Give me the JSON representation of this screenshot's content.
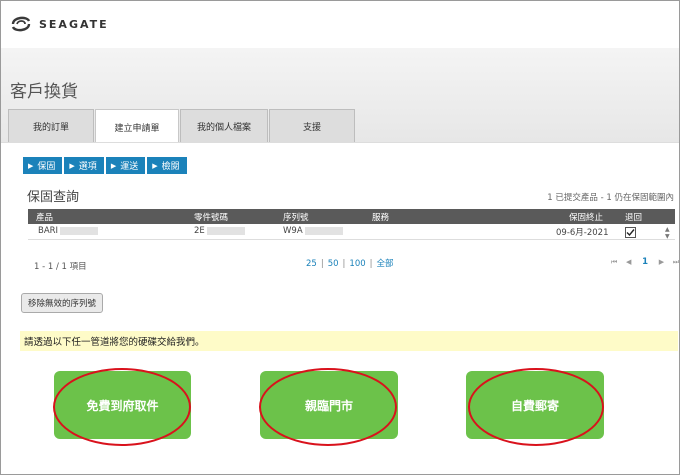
{
  "brand": {
    "logo_text": "SEAGATE",
    "logo_icon": "seagate-swirl-icon"
  },
  "page_title": "客戶換貨",
  "tabs": [
    {
      "label": "我的訂單",
      "active": false
    },
    {
      "label": "建立申請單",
      "active": true
    },
    {
      "label": "我的個人檔案",
      "active": false
    },
    {
      "label": "支援",
      "active": false
    }
  ],
  "steps": [
    "保固",
    "選項",
    "運送",
    "檢閱"
  ],
  "warranty": {
    "title": "保固查詢",
    "summary": "1 已提交產品 - 1 仍在保固範圍內",
    "columns": [
      "產品",
      "零件號碼",
      "序列號",
      "服務",
      "保固終止",
      "退回"
    ],
    "rows": [
      {
        "product": "BARI",
        "part_number": "2E",
        "serial": "W9A",
        "service": "",
        "warranty_end": "09-6月-2021",
        "returned": true
      }
    ],
    "count_text": "1 - 1 / 1 項目",
    "page_sizes": [
      "25",
      "50",
      "100",
      "全部"
    ],
    "pager": {
      "first": "⏮",
      "prev": "◀",
      "current": "1",
      "next": "▶",
      "last": "⏭"
    }
  },
  "remove_button": "移除無效的序列號",
  "notice": "請透過以下任一管道將您的硬碟交給我們。",
  "options": [
    "免費到府取件",
    "親臨門市",
    "自費郵寄"
  ],
  "colors": {
    "accent_blue": "#1b82ba",
    "option_green": "#6cc24a",
    "highlight_red": "#d9121c",
    "notice_yellow": "#fefbc8"
  }
}
